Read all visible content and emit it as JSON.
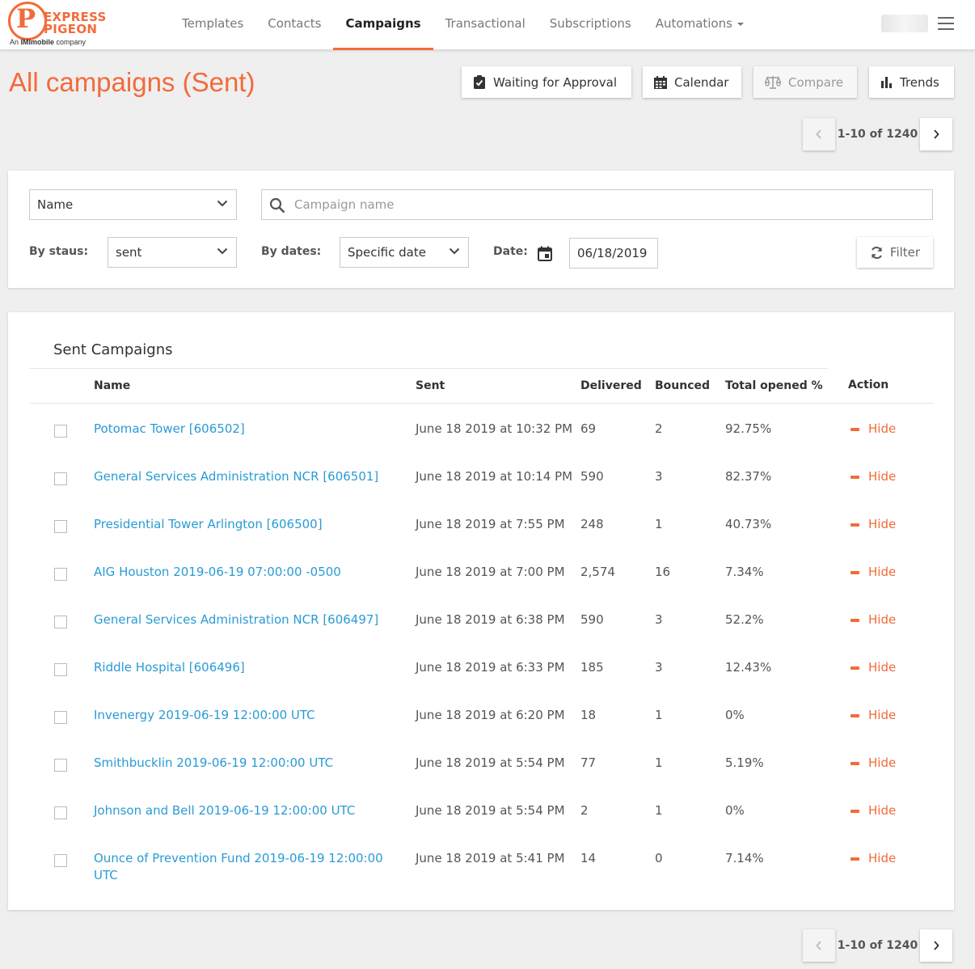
{
  "logo": {
    "word1": "EXPRESS",
    "word2": "PIGEON",
    "sub_prefix": "An ",
    "sub_brand": "IMImobile",
    "sub_suffix": " company"
  },
  "nav": {
    "items": [
      {
        "label": "Templates"
      },
      {
        "label": "Contacts"
      },
      {
        "label": "Campaigns",
        "active": true
      },
      {
        "label": "Transactional"
      },
      {
        "label": "Subscriptions"
      },
      {
        "label": "Automations",
        "dropdown": true
      }
    ]
  },
  "page": {
    "title": "All campaigns (Sent)"
  },
  "toolbar": {
    "approval_label": "Waiting for Approval",
    "calendar_label": "Calendar",
    "compare_label": "Compare",
    "trends_label": "Trends"
  },
  "pagination": {
    "info": "1-10 of 1240"
  },
  "filters": {
    "field_select": "Name",
    "search_placeholder": "Campaign name",
    "status_label": "By staus:",
    "status_value": "sent",
    "dates_label": "By dates:",
    "dates_value": "Specific date",
    "date_label": "Date:",
    "date_value": "06/18/2019",
    "filter_button": "Filter"
  },
  "table": {
    "title": "Sent Campaigns",
    "columns": {
      "name": "Name",
      "sent": "Sent",
      "delivered": "Delivered",
      "bounced": "Bounced",
      "opened": "Total opened %",
      "action": "Action"
    },
    "action_label": "Hide",
    "rows": [
      {
        "name": "Potomac Tower [606502]",
        "sent": "June 18 2019 at 10:32 PM",
        "delivered": "69",
        "bounced": "2",
        "opened": "92.75%"
      },
      {
        "name": "General Services Administration NCR [606501]",
        "sent": "June 18 2019 at 10:14 PM",
        "delivered": "590",
        "bounced": "3",
        "opened": "82.37%"
      },
      {
        "name": "Presidential Tower Arlington [606500]",
        "sent": "June 18 2019 at 7:55 PM",
        "delivered": "248",
        "bounced": "1",
        "opened": "40.73%"
      },
      {
        "name": "AIG Houston 2019-06-19 07:00:00 -0500",
        "sent": "June 18 2019 at 7:00 PM",
        "delivered": "2,574",
        "bounced": "16",
        "opened": "7.34%"
      },
      {
        "name": "General Services Administration NCR [606497]",
        "sent": "June 18 2019 at 6:38 PM",
        "delivered": "590",
        "bounced": "3",
        "opened": "52.2%"
      },
      {
        "name": "Riddle Hospital [606496]",
        "sent": "June 18 2019 at 6:33 PM",
        "delivered": "185",
        "bounced": "3",
        "opened": "12.43%"
      },
      {
        "name": "Invenergy 2019-06-19 12:00:00 UTC",
        "sent": "June 18 2019 at 6:20 PM",
        "delivered": "18",
        "bounced": "1",
        "opened": "0%"
      },
      {
        "name": "Smithbucklin 2019-06-19 12:00:00 UTC",
        "sent": "June 18 2019 at 5:54 PM",
        "delivered": "77",
        "bounced": "1",
        "opened": "5.19%"
      },
      {
        "name": "Johnson and Bell 2019-06-19 12:00:00 UTC",
        "sent": "June 18 2019 at 5:54 PM",
        "delivered": "2",
        "bounced": "1",
        "opened": "0%"
      },
      {
        "name": "Ounce of Prevention Fund 2019-06-19 12:00:00 UTC",
        "sent": "June 18 2019 at 5:41 PM",
        "delivered": "14",
        "bounced": "0",
        "opened": "7.14%"
      }
    ]
  },
  "colors": {
    "accent": "#f26b3a",
    "link": "#2a9bd5"
  }
}
